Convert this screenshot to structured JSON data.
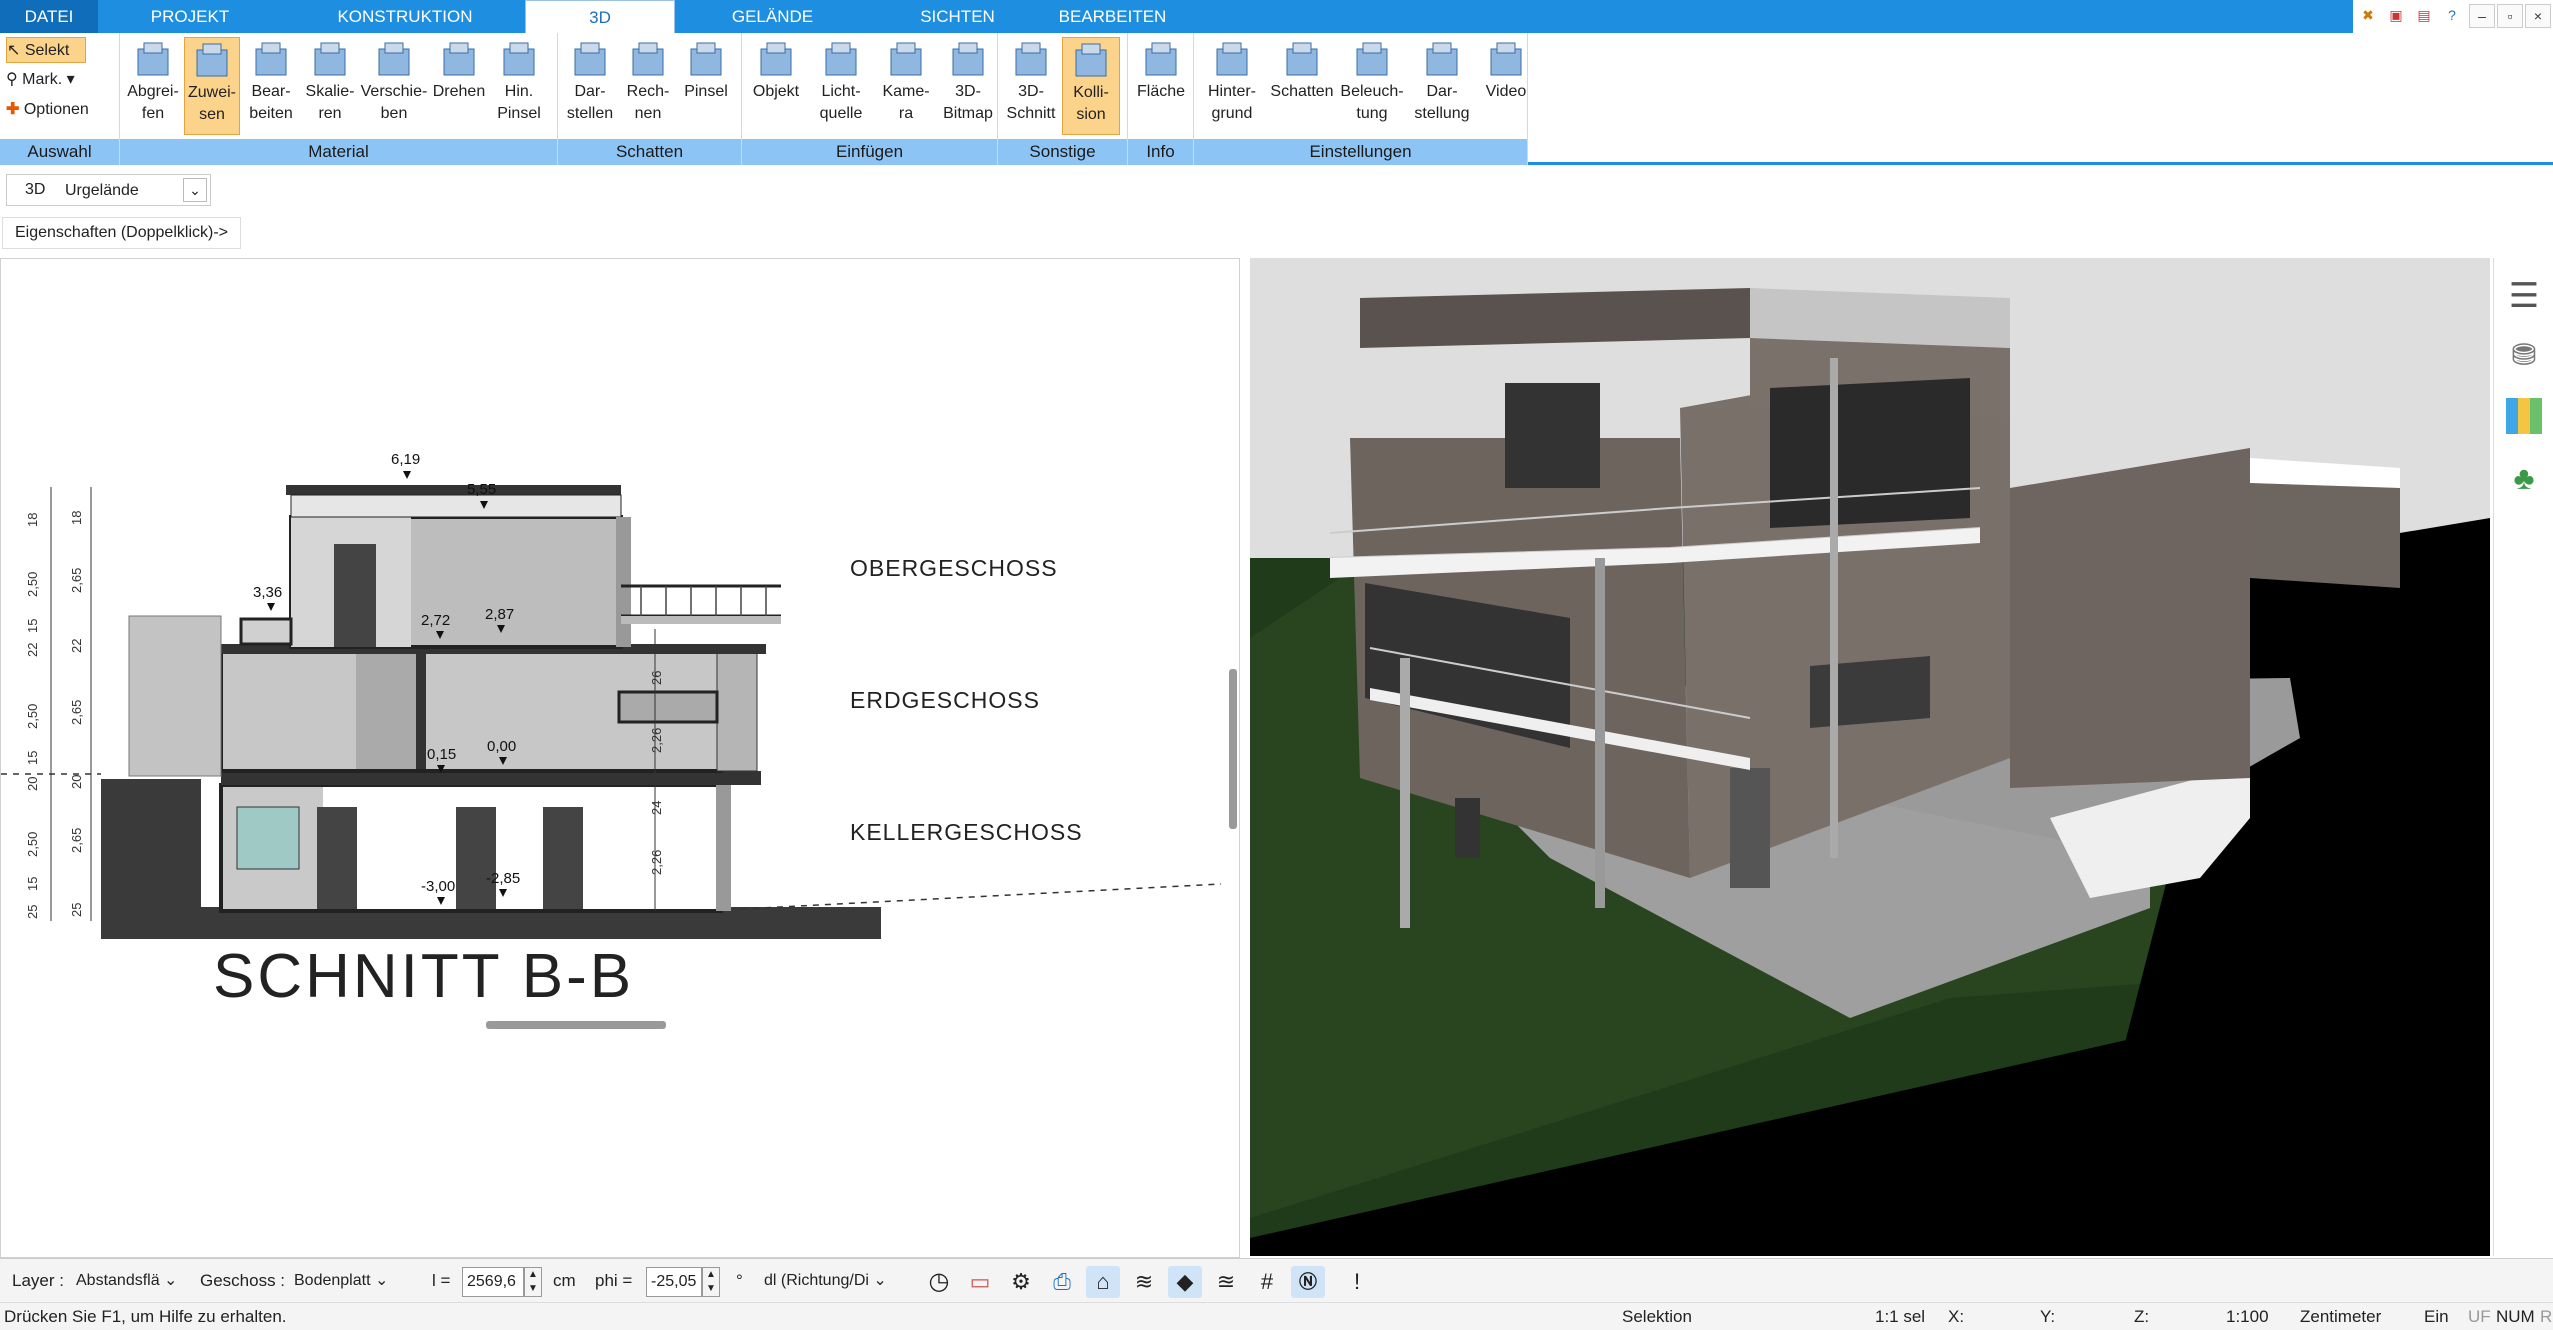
{
  "tabs": [
    "DATEI",
    "PROJEKT",
    "KONSTRUKTION",
    "3D",
    "GELÄNDE",
    "SICHTEN",
    "BEARBEITEN"
  ],
  "ribbon": {
    "auswahl": {
      "select": "Selekt",
      "mark": "Mark.",
      "options": "Optionen",
      "footer": "Auswahl"
    },
    "material": {
      "footer": "Material",
      "buttons": [
        [
          "Abgrei-",
          "fen"
        ],
        [
          "Zuwei-",
          "sen"
        ],
        [
          "Bear-",
          "beiten"
        ],
        [
          "Skalie-",
          "ren"
        ],
        [
          "Verschie-",
          "ben"
        ],
        [
          "Drehen",
          ""
        ],
        [
          "Hin.",
          "Pinsel"
        ]
      ]
    },
    "schatten": {
      "footer": "Schatten",
      "buttons": [
        [
          "Dar-",
          "stellen"
        ],
        [
          "Rech-",
          "nen"
        ],
        [
          "Pinsel",
          ""
        ]
      ]
    },
    "einfuegen": {
      "footer": "Einfügen",
      "buttons": [
        [
          "Objekt",
          ""
        ],
        [
          "Licht-",
          "quelle"
        ],
        [
          "Kame-",
          "ra"
        ],
        [
          "3D-",
          "Bitmap"
        ]
      ]
    },
    "sonstige": {
      "footer": "Sonstige",
      "buttons": [
        [
          "3D-",
          "Schnitt"
        ],
        [
          "Kolli-",
          "sion"
        ]
      ]
    },
    "info": {
      "footer": "Info",
      "buttons": [
        [
          "Fläche",
          ""
        ]
      ]
    },
    "einstellungen": {
      "footer": "Einstellungen",
      "buttons": [
        [
          "Hinter-",
          "grund"
        ],
        [
          "Schatten",
          ""
        ],
        [
          "Beleuch-",
          "tung"
        ],
        [
          "Dar-",
          "stellung"
        ],
        [
          "Video",
          ""
        ]
      ]
    }
  },
  "viewbar": {
    "mode": "3D",
    "terrain": "Urgelände"
  },
  "properties_hint": "Eigenschaften (Doppelklick)->",
  "section": {
    "title": "SCHNITT B-B",
    "floors": [
      "OBERGESCHOSS",
      "ERDGESCHOSS",
      "KELLERGESCHOSS"
    ],
    "levels": [
      "6,19",
      "5,55",
      "3,36",
      "2,72",
      "2,87",
      "0,15",
      "0,00",
      "-3,00",
      "-2,85"
    ],
    "dims_left": [
      "18",
      "2,50",
      "15",
      "22",
      "2,50",
      "15",
      "20",
      "2,50",
      "15",
      "25"
    ],
    "dims_left2": [
      "18",
      "2,65",
      "22",
      "2,65",
      "20",
      "2,65",
      "25"
    ],
    "dims_mid": [
      "26",
      "2,26",
      "24",
      "2,26"
    ]
  },
  "statusbar": {
    "layer_label": "Layer :",
    "layer_value": "Abstandsflä",
    "geschoss_label": "Geschoss :",
    "geschoss_value": "Bodenplatt",
    "l_label": "l =",
    "l_value": "2569,6",
    "l_unit": "cm",
    "phi_label": "phi =",
    "phi_value": "-25,05",
    "phi_unit": "°",
    "dl_value": "dl (Richtung/Di"
  },
  "footer": {
    "help": "Drücken Sie F1, um Hilfe zu erhalten.",
    "mode": "Selektion",
    "scale_sel": "1:1 sel",
    "x": "X:",
    "y": "Y:",
    "z": "Z:",
    "scale": "1:100",
    "unit": "Zentimeter",
    "ein": "Ein",
    "uf": "UF",
    "num": "NUM",
    "ri": "RI"
  },
  "colors": {
    "accent": "#1e8fe0",
    "ribbon_footer": "#8cc4f5",
    "active_btn": "#fbd38a",
    "grass": "#2a4a1e"
  }
}
